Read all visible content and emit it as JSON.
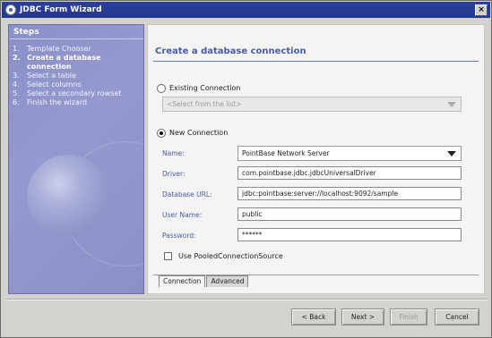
{
  "window": {
    "title": "JDBC Form Wizard",
    "close_label": "×"
  },
  "steps": {
    "header": "Steps",
    "items": [
      {
        "num": "1.",
        "label": "Template Chooser"
      },
      {
        "num": "2.",
        "label": "Create a database connection"
      },
      {
        "num": "3.",
        "label": "Select a table"
      },
      {
        "num": "4.",
        "label": "Select columns"
      },
      {
        "num": "5.",
        "label": "Select a secondary rowset"
      },
      {
        "num": "6.",
        "label": "Finish the wizard"
      }
    ],
    "active_index": 1
  },
  "main": {
    "title": "Create a database connection",
    "existing": {
      "label": "Existing Connection",
      "placeholder": "<Select from the list>",
      "selected": false
    },
    "new": {
      "label": "New Connection",
      "selected": true,
      "name_label": "Name:",
      "name_value": "PointBase Network Server",
      "driver_label": "Driver:",
      "driver_value": "com.pointbase.jdbc.jdbcUniversalDriver",
      "url_label": "Database URL:",
      "url_value": "jdbc:pointbase:server://localhost:9092/sample",
      "user_label": "User Name:",
      "user_value": "public",
      "password_label": "Password:",
      "password_value": "******"
    },
    "pooled": {
      "label": "Use PooledConnectionSource",
      "checked": false
    },
    "tabs": [
      {
        "label": "Connection",
        "active": true
      },
      {
        "label": "Advanced",
        "active": false
      }
    ]
  },
  "buttons": {
    "back": "< Back",
    "next": "Next >",
    "finish": "Finish",
    "cancel": "Cancel"
  }
}
